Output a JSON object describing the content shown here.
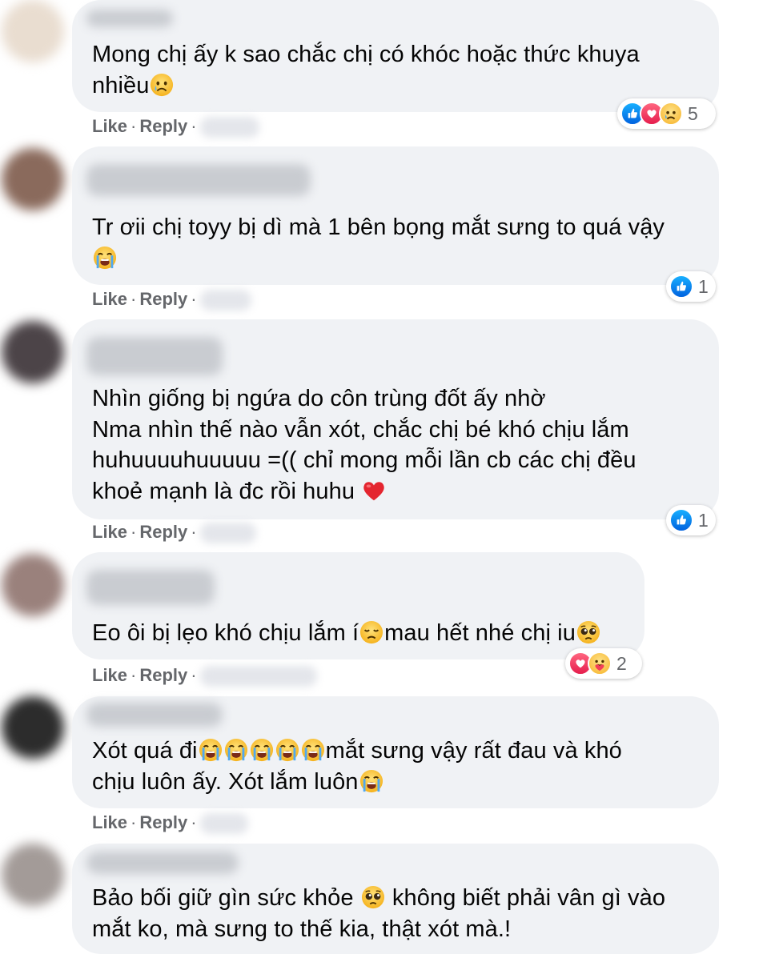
{
  "actions": {
    "like": "Like",
    "reply": "Reply",
    "sep": "·"
  },
  "colors": {
    "bubble": "#f0f2f5",
    "action_text": "#65676b",
    "like_blue": "#1877f2",
    "love_red": "#f33e58",
    "emoji_yellow": "#f7b125"
  },
  "comments": [
    {
      "text_a": "Mong chị ấy k sao chắc chị có khóc hoặc thức khuya\nnhiều",
      "emoji_a": "sad-face-icon",
      "reactions": [
        "like-icon",
        "love-icon",
        "sad-icon"
      ],
      "reaction_count": "5"
    },
    {
      "text_a": "Tr ơii chị toyy bị dì mà 1 bên bọng mắt sưng to quá vậy\n",
      "emoji_a": "loudly-crying-face-icon",
      "reactions": [
        "like-icon"
      ],
      "reaction_count": "1"
    },
    {
      "text_a": "Nhìn giống bị ngứa do côn trùng đốt ấy nhờ\nNma nhìn thế nào vẫn xót, chắc chị bé khó chịu lắm\nhuhuuuuhuuuuu =(( chỉ mong mỗi lần cb các chị đều\nkhoẻ mạnh là đc rồi huhu ",
      "emoji_a": "red-heart-icon",
      "reactions": [
        "like-icon"
      ],
      "reaction_count": "1"
    },
    {
      "text_a": "Eo ôi bị lẹo khó chịu lắm í",
      "emoji_a": "disappointed-face-icon",
      "text_b": "mau hết nhé chị iu",
      "emoji_b": "pleading-face-icon",
      "reactions": [
        "love-icon",
        "care-icon"
      ],
      "reaction_count": "2"
    },
    {
      "text_a": "Xót quá đi",
      "emoji_a": "loudly-crying-face-icon",
      "text_b": "mắt sưng vậy rất đau và khó\nchịu luôn ấy. Xót lắm luôn",
      "emoji_b": "loudly-crying-face-icon"
    },
    {
      "text_a": "Bảo bối giữ gìn sức khỏe ",
      "emoji_a": "pleading-face-icon",
      "text_b": " không biết phải vân gì vào\nmắt ko, mà sưng to thế kia, thật xót mà.!"
    }
  ]
}
